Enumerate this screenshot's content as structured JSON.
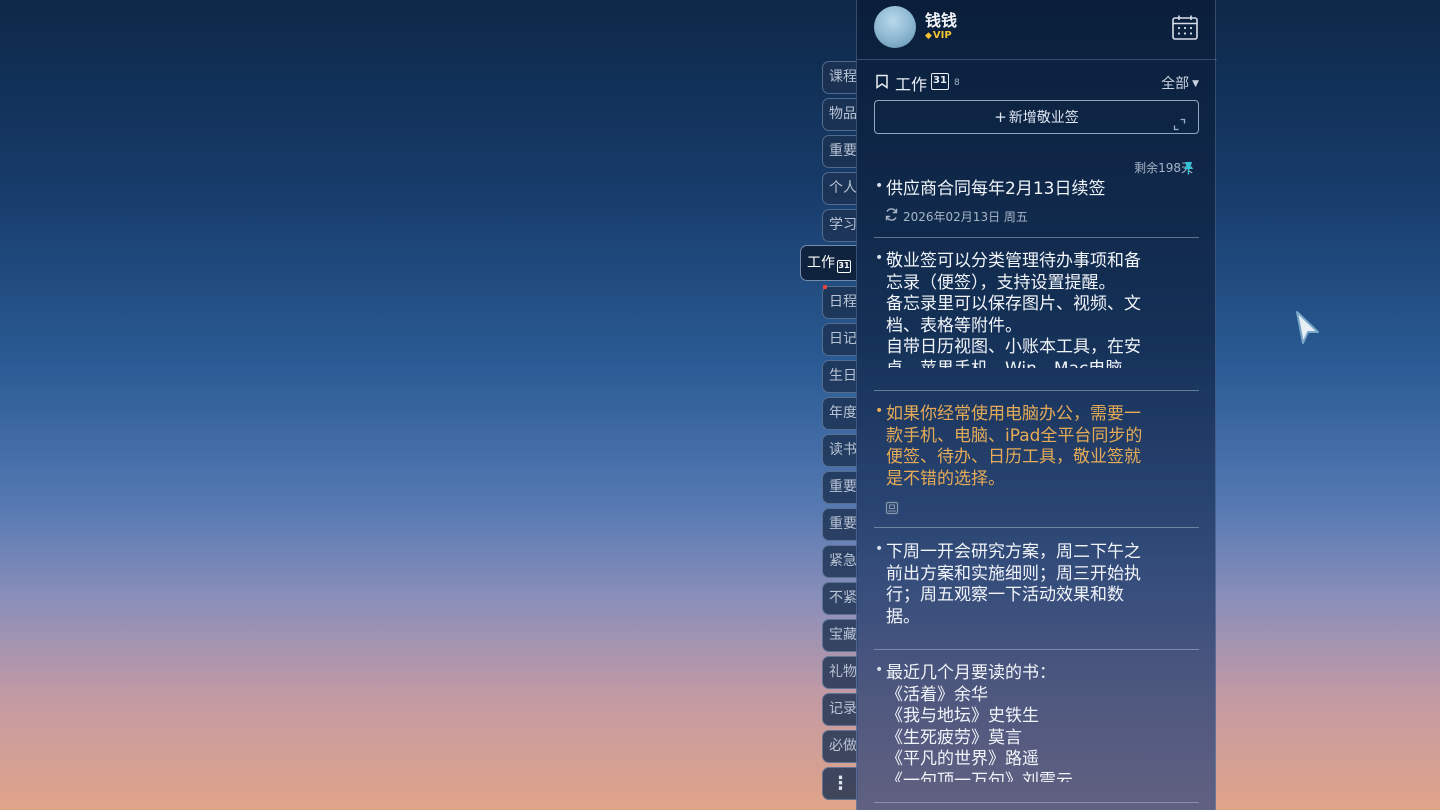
{
  "user": {
    "name": "钱钱",
    "vip_label": "VIP"
  },
  "side_tabs": [
    {
      "label": "课程"
    },
    {
      "label": "物品"
    },
    {
      "label": "重要"
    },
    {
      "label": "个人"
    },
    {
      "label": "学习"
    },
    {
      "label": "工作",
      "active": true,
      "badge": "31"
    },
    {
      "label": "日程"
    },
    {
      "label": "日记"
    },
    {
      "label": "生日"
    },
    {
      "label": "年度"
    },
    {
      "label": "读书"
    },
    {
      "label": "重要"
    },
    {
      "label": "重要"
    },
    {
      "label": "紧急"
    },
    {
      "label": "不紧"
    },
    {
      "label": "宝藏"
    },
    {
      "label": "礼物"
    },
    {
      "label": "记录"
    },
    {
      "label": "必做"
    },
    {
      "label": "⋮"
    }
  ],
  "category": {
    "title": "工作",
    "badge": "31",
    "count": "8",
    "filter": "全部"
  },
  "add_note": {
    "label": "新增敬业签"
  },
  "notes": [
    {
      "remaining": "剩余198天",
      "text": "供应商合同每年2月13日续签",
      "date": "2026年02月13日  周五"
    },
    {
      "text": "敬业签可以分类管理待办事项和备\n忘录（便签），支持设置提醒。\n备忘录里可以保存图片、视频、文\n档、表格等附件。\n自带日历视图、小账本工具，在安\n卓、苹果手机、Win、Mac电脑"
    },
    {
      "text": "如果你经常使用电脑办公，需要一\n款手机、电脑、iPad全平台同步的\n便签、待办、日历工具，敬业签就\n是不错的选择。",
      "color": "#e6ab57"
    },
    {
      "text": "下周一开会研究方案，周二下午之\n前出方案和实施细则；周三开始执\n行；周五观察一下活动效果和数\n据。"
    },
    {
      "text": "最近几个月要读的书：\n《活着》余华\n《我与地坛》史铁生\n《生死疲劳》莫言\n《平凡的世界》路遥\n《一句顶一万句》刘震云"
    }
  ],
  "colors": {
    "vip": "#f1c232",
    "pin": "#36c2d6",
    "highlight_note": "#e6ab57",
    "active_tab_dot": "#e2453c"
  }
}
